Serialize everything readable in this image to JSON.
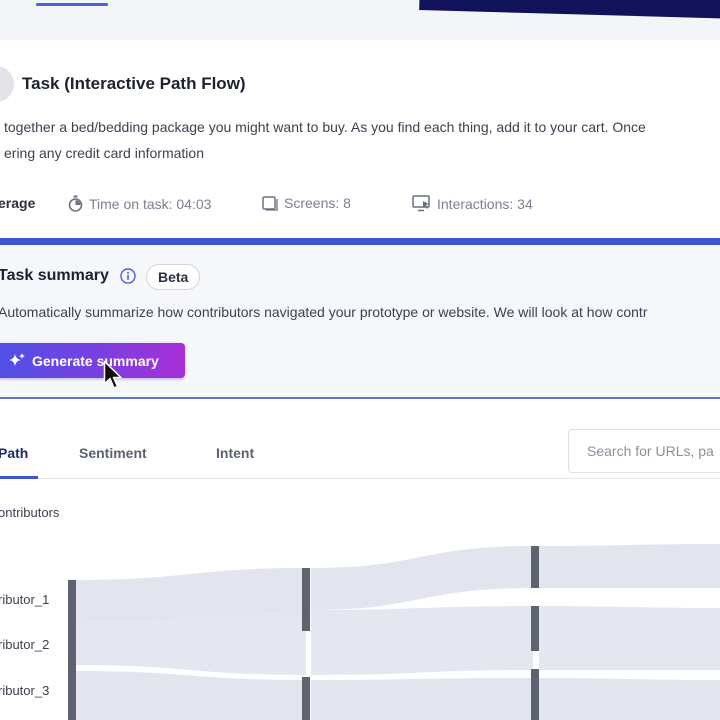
{
  "task": {
    "title": "Task (Interactive Path Flow)",
    "description_line1": "together a bed/bedding package you might want to buy. As you find each thing, add it to your cart. Once",
    "description_line2": "ering any credit card information"
  },
  "metrics": {
    "average_label": "erage",
    "time_label": "Time on task: 04:03",
    "screens_label": "Screens:  8",
    "interactions_label": "Interactions: 34"
  },
  "summary": {
    "title": "Task summary",
    "badge": "Beta",
    "description": "Automatically summarize how contributors navigated your prototype or website. We will look at how contr",
    "button_label": "Generate summary"
  },
  "tabs": [
    {
      "label": "Path",
      "active": true
    },
    {
      "label": "Sentiment",
      "active": false
    },
    {
      "label": "Intent",
      "active": false
    }
  ],
  "search": {
    "placeholder": "Search for URLs, pa"
  },
  "flow": {
    "header": "ontributors",
    "rows": [
      "ributor_1",
      "ributor_2",
      "ributor_3"
    ]
  },
  "icons": {
    "timer": "stopwatch-icon",
    "screens": "screens-icon",
    "interactions": "monitor-cursor-icon",
    "info": "info-icon",
    "sparkle": "sparkle-icon"
  },
  "colors": {
    "accent": "#3d55d0",
    "button_gradient_start": "#4f51e6",
    "button_gradient_end": "#a82ed6",
    "flow_band": "#e2e5ee",
    "flow_node": "#5e6370"
  }
}
